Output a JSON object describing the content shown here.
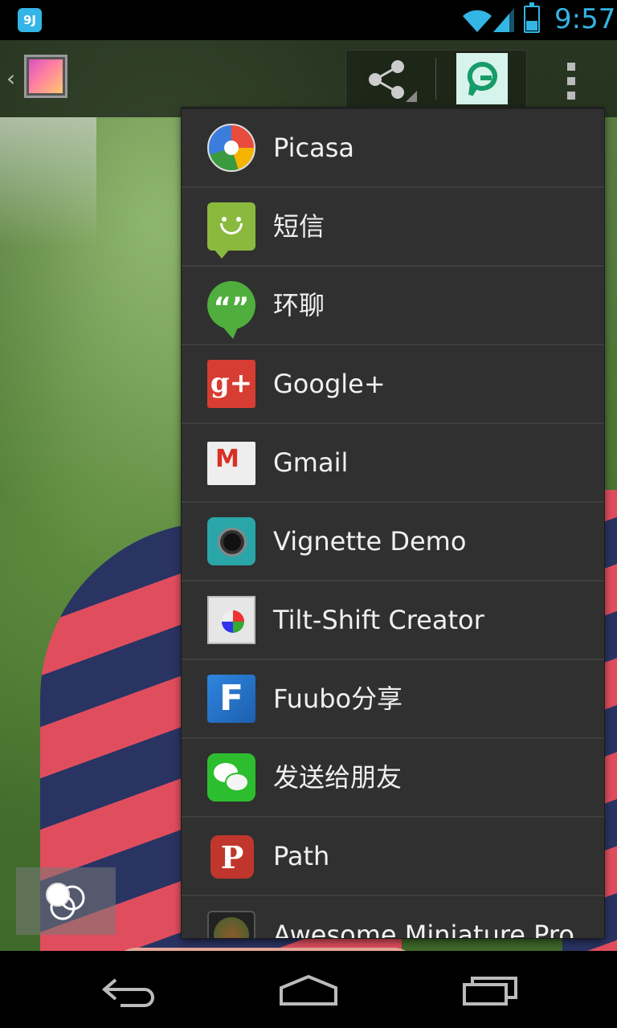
{
  "status_bar": {
    "app_icon_text": "9J",
    "time": "9:57",
    "icons": [
      "wifi-icon",
      "signal-icon",
      "battery-icon"
    ]
  },
  "action_bar": {
    "icons": [
      "up-caret-icon",
      "gallery-icon",
      "share-icon",
      "recent-share-app-icon",
      "overflow-menu-icon"
    ]
  },
  "share_menu": {
    "items": [
      {
        "label": "Picasa",
        "icon": "picasa-icon"
      },
      {
        "label": "短信",
        "icon": "messaging-icon"
      },
      {
        "label": "环聊",
        "icon": "hangouts-icon",
        "glyph": "“”"
      },
      {
        "label": "Google+",
        "icon": "google-plus-icon",
        "glyph": "g+"
      },
      {
        "label": "Gmail",
        "icon": "gmail-icon",
        "glyph": "M"
      },
      {
        "label": "Vignette Demo",
        "icon": "vignette-camera-icon"
      },
      {
        "label": "Tilt-Shift Creator",
        "icon": "tilt-shift-icon"
      },
      {
        "label": "Fuubo分享",
        "icon": "fuubo-icon",
        "glyph": "F"
      },
      {
        "label": "发送给朋友",
        "icon": "wechat-icon"
      },
      {
        "label": "Path",
        "icon": "path-icon",
        "glyph": "P"
      },
      {
        "label": "Awesome Miniature Pro",
        "icon": "miniature-icon"
      }
    ]
  },
  "filters": {
    "icon": "filters-icon"
  },
  "nav_bar": {
    "icons": [
      "back-icon",
      "home-icon",
      "recent-apps-icon"
    ]
  },
  "colors": {
    "accent": "#33b5e5",
    "menu_background": "#303030",
    "menu_divider": "#3e3e3e",
    "menu_text": "#f0f0f0"
  }
}
